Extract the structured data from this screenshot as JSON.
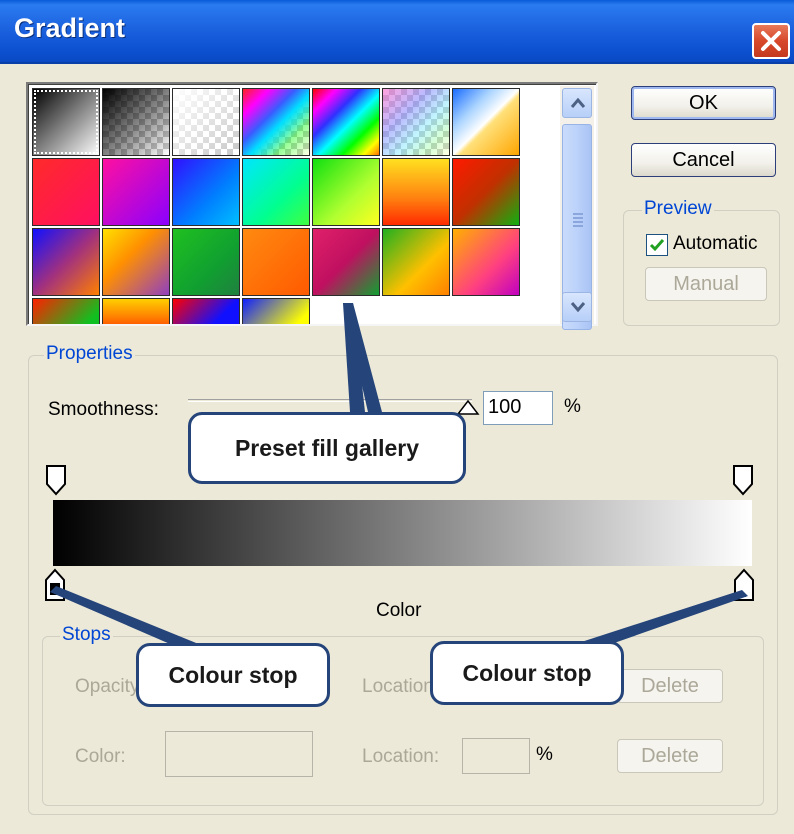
{
  "window": {
    "title": "Gradient"
  },
  "gallery": {
    "tiles": [
      {
        "name": "gradient-preset-black-white"
      },
      {
        "name": "gradient-preset-black-transparent"
      },
      {
        "name": "gradient-preset-white-transparent"
      },
      {
        "name": "gradient-preset-rainbow-transparent"
      },
      {
        "name": "gradient-preset-rainbow"
      },
      {
        "name": "gradient-preset-pastel-transparent"
      },
      {
        "name": "gradient-preset-blue-white-orange"
      },
      {
        "name": "gradient-preset-red"
      },
      {
        "name": "gradient-preset-magenta"
      },
      {
        "name": "gradient-preset-blue"
      },
      {
        "name": "gradient-preset-teal-green"
      },
      {
        "name": "gradient-preset-green-yellow"
      },
      {
        "name": "gradient-preset-yellow-red"
      },
      {
        "name": "gradient-preset-red-green"
      },
      {
        "name": "gradient-preset-blue-orange"
      },
      {
        "name": "gradient-preset-yellow-violet"
      },
      {
        "name": "gradient-preset-green"
      },
      {
        "name": "gradient-preset-orange"
      },
      {
        "name": "gradient-preset-crimson-green"
      },
      {
        "name": "gradient-preset-green-orange"
      },
      {
        "name": "gradient-preset-orange-magenta"
      },
      {
        "name": "gradient-preset-red-green-2"
      },
      {
        "name": "gradient-preset-yellow-red-2"
      },
      {
        "name": "gradient-preset-blue-red"
      },
      {
        "name": "gradient-preset-blue-yellow"
      }
    ]
  },
  "buttons": {
    "ok": "OK",
    "cancel": "Cancel",
    "manual": "Manual"
  },
  "preview": {
    "legend": "Preview",
    "automatic_label": "Automatic",
    "automatic_checked": true
  },
  "properties": {
    "legend": "Properties",
    "smoothness_label": "Smoothness:",
    "smoothness_value": "100",
    "percent": "%"
  },
  "gradient": {
    "start_color": "#000000",
    "end_color": "#ffffff",
    "stop_label": "Color"
  },
  "stops": {
    "legend": "Stops",
    "opacity_label": "Opacity:",
    "location_label": "Location:",
    "delete_label": "Delete",
    "color_label": "Color:",
    "percent": "%"
  },
  "annotations": {
    "gallery_callout": "Preset fill gallery",
    "stop_callout_left": "Colour stop",
    "stop_callout_right": "Colour stop"
  },
  "icons": {
    "close": "close-icon",
    "scroll_up": "chevron-up-icon",
    "scroll_down": "chevron-down-icon",
    "check": "check-icon",
    "stop_marker": "stop-marker-icon"
  },
  "colors": {
    "title_bar": "#1c63e0",
    "dialog_bg": "#ece9d8",
    "group_label": "#0046d5",
    "callout_border": "#25447a"
  }
}
